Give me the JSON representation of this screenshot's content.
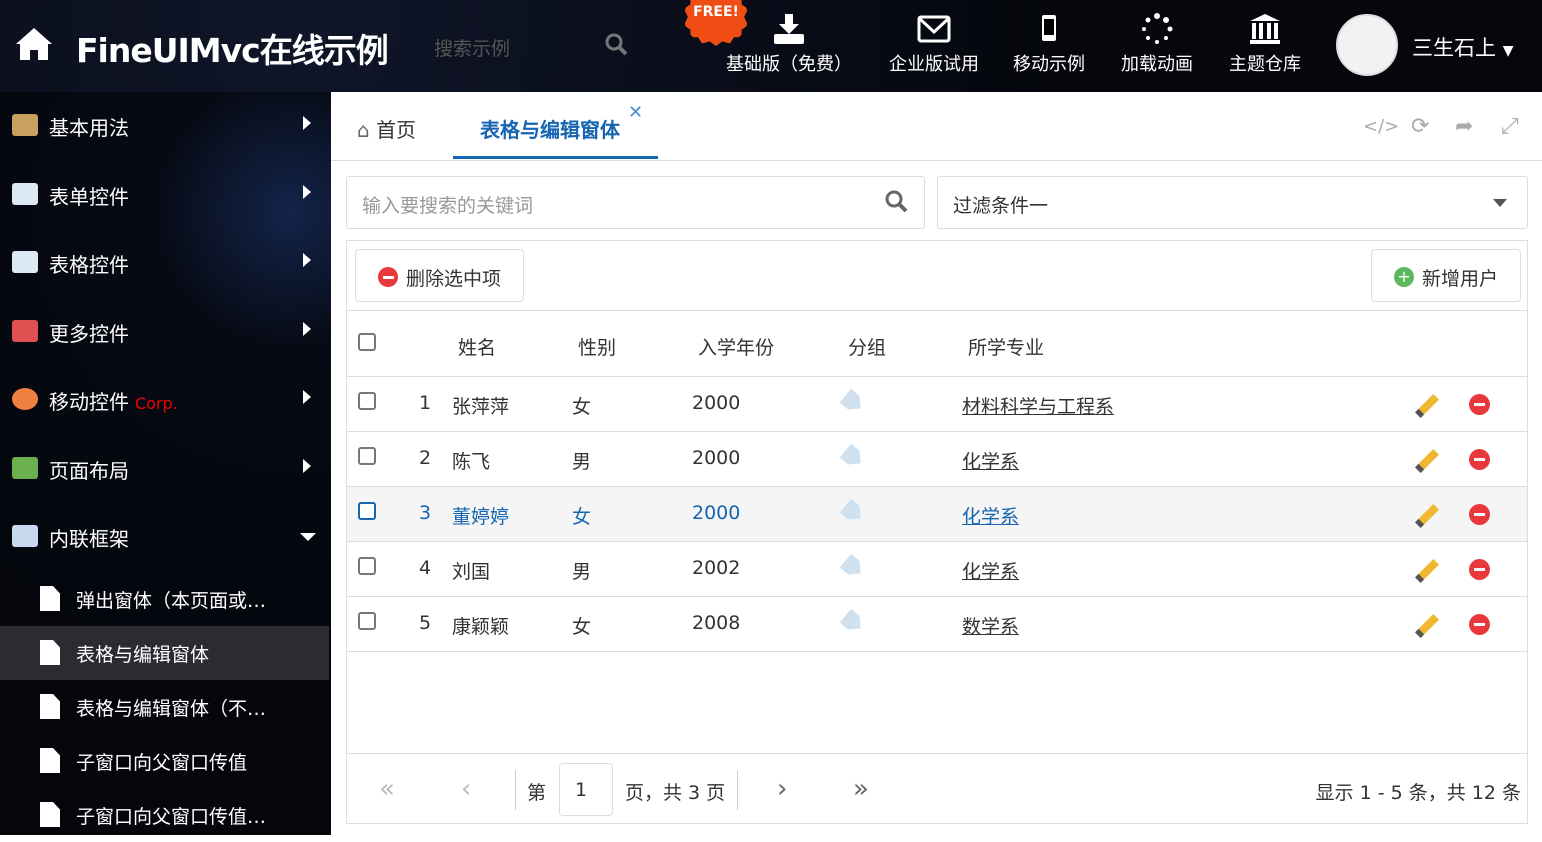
{
  "header": {
    "title": "FineUIMvc在线示例",
    "search_placeholder": "搜索示例",
    "free_badge": "FREE!",
    "nav": [
      {
        "label": "基础版（免费）",
        "icon": "download-icon"
      },
      {
        "label": "企业版试用",
        "icon": "envelope-icon"
      },
      {
        "label": "移动示例",
        "icon": "mobile-icon"
      },
      {
        "label": "加载动画",
        "icon": "spinner-icon"
      },
      {
        "label": "主题仓库",
        "icon": "bank-icon"
      }
    ],
    "user": "三生石上"
  },
  "sidebar": {
    "items": [
      {
        "label": "基本用法",
        "color": "#c9a060"
      },
      {
        "label": "表单控件",
        "color": "#dde8f5"
      },
      {
        "label": "表格控件",
        "color": "#dde8f5"
      },
      {
        "label": "更多控件",
        "color": "#e05050"
      },
      {
        "label": "移动控件",
        "badge": "Corp.",
        "color": "#f08040"
      },
      {
        "label": "页面布局",
        "color": "#6ab04c"
      },
      {
        "label": "内联框架",
        "color": "#c8d8ee"
      }
    ],
    "children": [
      "弹出窗体（本页面或…",
      "表格与编辑窗体",
      "表格与编辑窗体（不…",
      "子窗口向父窗口传值",
      "子窗口向父窗口传值…"
    ],
    "selected_child": 1
  },
  "tabs": [
    {
      "label": "首页"
    },
    {
      "label": "表格与编辑窗体"
    }
  ],
  "tab_tools": [
    "</>",
    "⟳",
    "➦",
    "⤢"
  ],
  "search": {
    "placeholder": "输入要搜索的关键词"
  },
  "filter": {
    "value": "过滤条件一"
  },
  "toolbar": {
    "delete_label": "删除选中项",
    "add_label": "新增用户"
  },
  "columns": [
    "姓名",
    "性别",
    "入学年份",
    "分组",
    "所学专业"
  ],
  "rows": [
    {
      "n": "1",
      "name": "张萍萍",
      "sex": "女",
      "year": "2000",
      "major": "材料科学与工程系"
    },
    {
      "n": "2",
      "name": "陈飞",
      "sex": "男",
      "year": "2000",
      "major": "化学系"
    },
    {
      "n": "3",
      "name": "董婷婷",
      "sex": "女",
      "year": "2000",
      "major": "化学系"
    },
    {
      "n": "4",
      "name": "刘国",
      "sex": "男",
      "year": "2002",
      "major": "化学系"
    },
    {
      "n": "5",
      "name": "康颖颖",
      "sex": "女",
      "year": "2008",
      "major": "数学系"
    }
  ],
  "highlighted_row": 2,
  "pager": {
    "first": "«",
    "prev": "‹",
    "next": "›",
    "last": "»",
    "page_prefix": "第",
    "page": "1",
    "page_suffix": "页，共 3 页",
    "summary": "显示 1 - 5 条，共 12 条"
  }
}
